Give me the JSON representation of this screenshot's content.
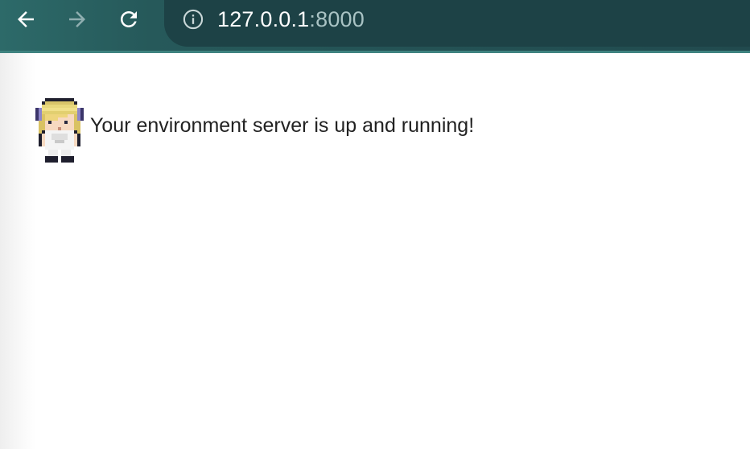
{
  "browser": {
    "url_host": "127.0.0.1",
    "url_port": ":8000",
    "icons": {
      "back": "arrow-left-icon",
      "forward": "arrow-right-icon",
      "reload": "reload-icon",
      "info": "info-icon"
    },
    "colors": {
      "toolbar": "#214a4e",
      "omnibox": "#1d4246",
      "accent": "#3f8380"
    }
  },
  "page": {
    "message": "Your environment server is up and running!",
    "avatar_icon": "pixel-character-avatar"
  }
}
